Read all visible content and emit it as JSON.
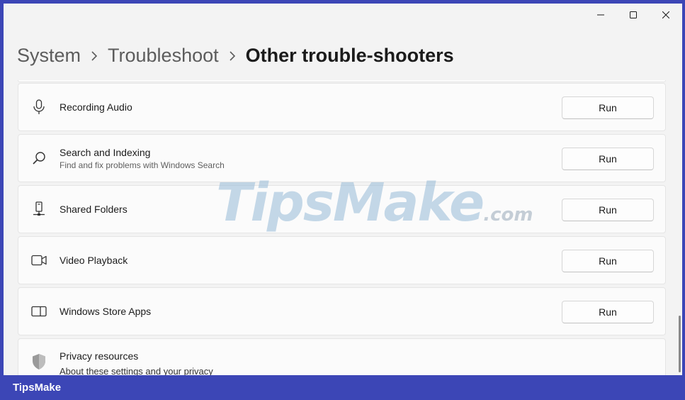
{
  "window_controls": {
    "minimize_icon": "minimize-icon",
    "maximize_icon": "maximize-icon",
    "close_icon": "close-icon"
  },
  "breadcrumb": {
    "items": [
      "System",
      "Troubleshoot",
      "Other trouble-shooters"
    ]
  },
  "troubleshooters": [
    {
      "title": "Recording Audio",
      "description": "",
      "icon": "microphone-icon",
      "button": "Run"
    },
    {
      "title": "Search and Indexing",
      "description": "Find and fix problems with Windows Search",
      "icon": "search-icon",
      "button": "Run"
    },
    {
      "title": "Shared Folders",
      "description": "",
      "icon": "shared-folder-icon",
      "button": "Run"
    },
    {
      "title": "Video Playback",
      "description": "",
      "icon": "video-camera-icon",
      "button": "Run"
    },
    {
      "title": "Windows Store Apps",
      "description": "",
      "icon": "store-apps-icon",
      "button": "Run"
    }
  ],
  "privacy": {
    "title": "Privacy resources",
    "description": "About these settings and your privacy",
    "icon": "shield-icon"
  },
  "watermark": {
    "main": "TipsMake",
    "suffix": ".com"
  },
  "footer": {
    "brand": "TipsMake"
  },
  "colors": {
    "frame": "#3c46b6",
    "window_bg": "#f3f3f3",
    "card_bg": "#fbfbfb"
  }
}
